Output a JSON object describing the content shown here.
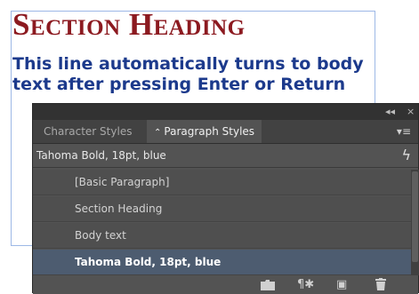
{
  "document": {
    "section_heading": "Section Heading",
    "body_text": "This line automatically turns to body text after pressing Enter or Return"
  },
  "panel": {
    "titlebar": {
      "collapse_icon": "◂◂",
      "close_icon": "×"
    },
    "tabs": [
      {
        "label": "Character Styles",
        "active": false
      },
      {
        "label": "Paragraph Styles",
        "active": true,
        "arrows": "⌃⌄"
      }
    ],
    "menu_icon": "≡",
    "current_style": "Tahoma Bold, 18pt, blue",
    "lightning_icon": "ϟ",
    "styles": [
      {
        "label": "[Basic Paragraph]",
        "selected": false
      },
      {
        "label": "Section Heading",
        "selected": false
      },
      {
        "label": "Body text",
        "selected": false
      },
      {
        "label": "Tahoma Bold, 18pt, blue",
        "selected": true
      }
    ],
    "footer_icons": {
      "clear_overrides": "¶✱",
      "new_style": "▣",
      "delete": "␡"
    }
  },
  "colors": {
    "heading": "#8c1a20",
    "body": "#1c3a8c",
    "panel_bg": "#535353",
    "selected_row": "#4d5c70"
  }
}
